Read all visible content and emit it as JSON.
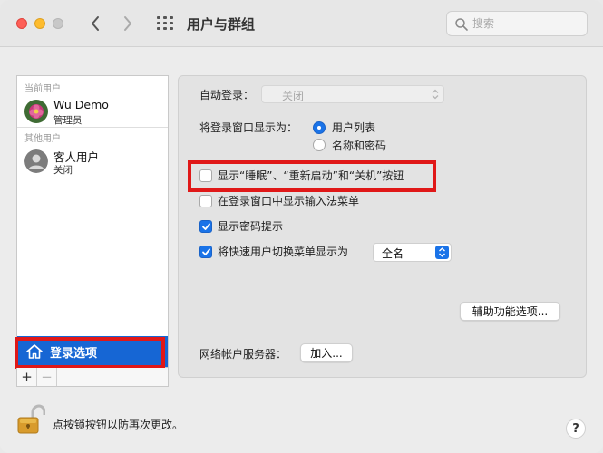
{
  "window": {
    "title": "用户与群组"
  },
  "search": {
    "placeholder": "搜索"
  },
  "sidebar": {
    "current_section": "当前用户",
    "other_section": "其他用户",
    "users": [
      {
        "name": "Wu Demo",
        "role": "管理员"
      },
      {
        "name": "客人用户",
        "role": "关闭"
      }
    ],
    "login_options": "登录选项",
    "add_label": "+",
    "remove_label": "−"
  },
  "main": {
    "auto_login_label": "自动登录：",
    "auto_login_value": "关闭",
    "display_as_label": "将登录窗口显示为：",
    "radio_options": [
      "用户列表",
      "名称和密码"
    ],
    "checkboxes": [
      {
        "label": "显示“睡眠”、“重新启动”和“关机”按钮",
        "checked": false
      },
      {
        "label": "在登录窗口中显示输入法菜单",
        "checked": false
      },
      {
        "label": "显示密码提示",
        "checked": true
      },
      {
        "label": "将快速用户切换菜单显示为",
        "checked": true
      }
    ],
    "fast_switch_value": "全名",
    "accessibility_button": "辅助功能选项...",
    "network_label": "网络帐户服务器：",
    "join_button": "加入..."
  },
  "footer": {
    "lock_text": "点按锁按钮以防再次更改。",
    "help_label": "?"
  },
  "colors": {
    "accent": "#1a73e8",
    "selection": "#1666d4",
    "highlight_red": "#e01818"
  }
}
